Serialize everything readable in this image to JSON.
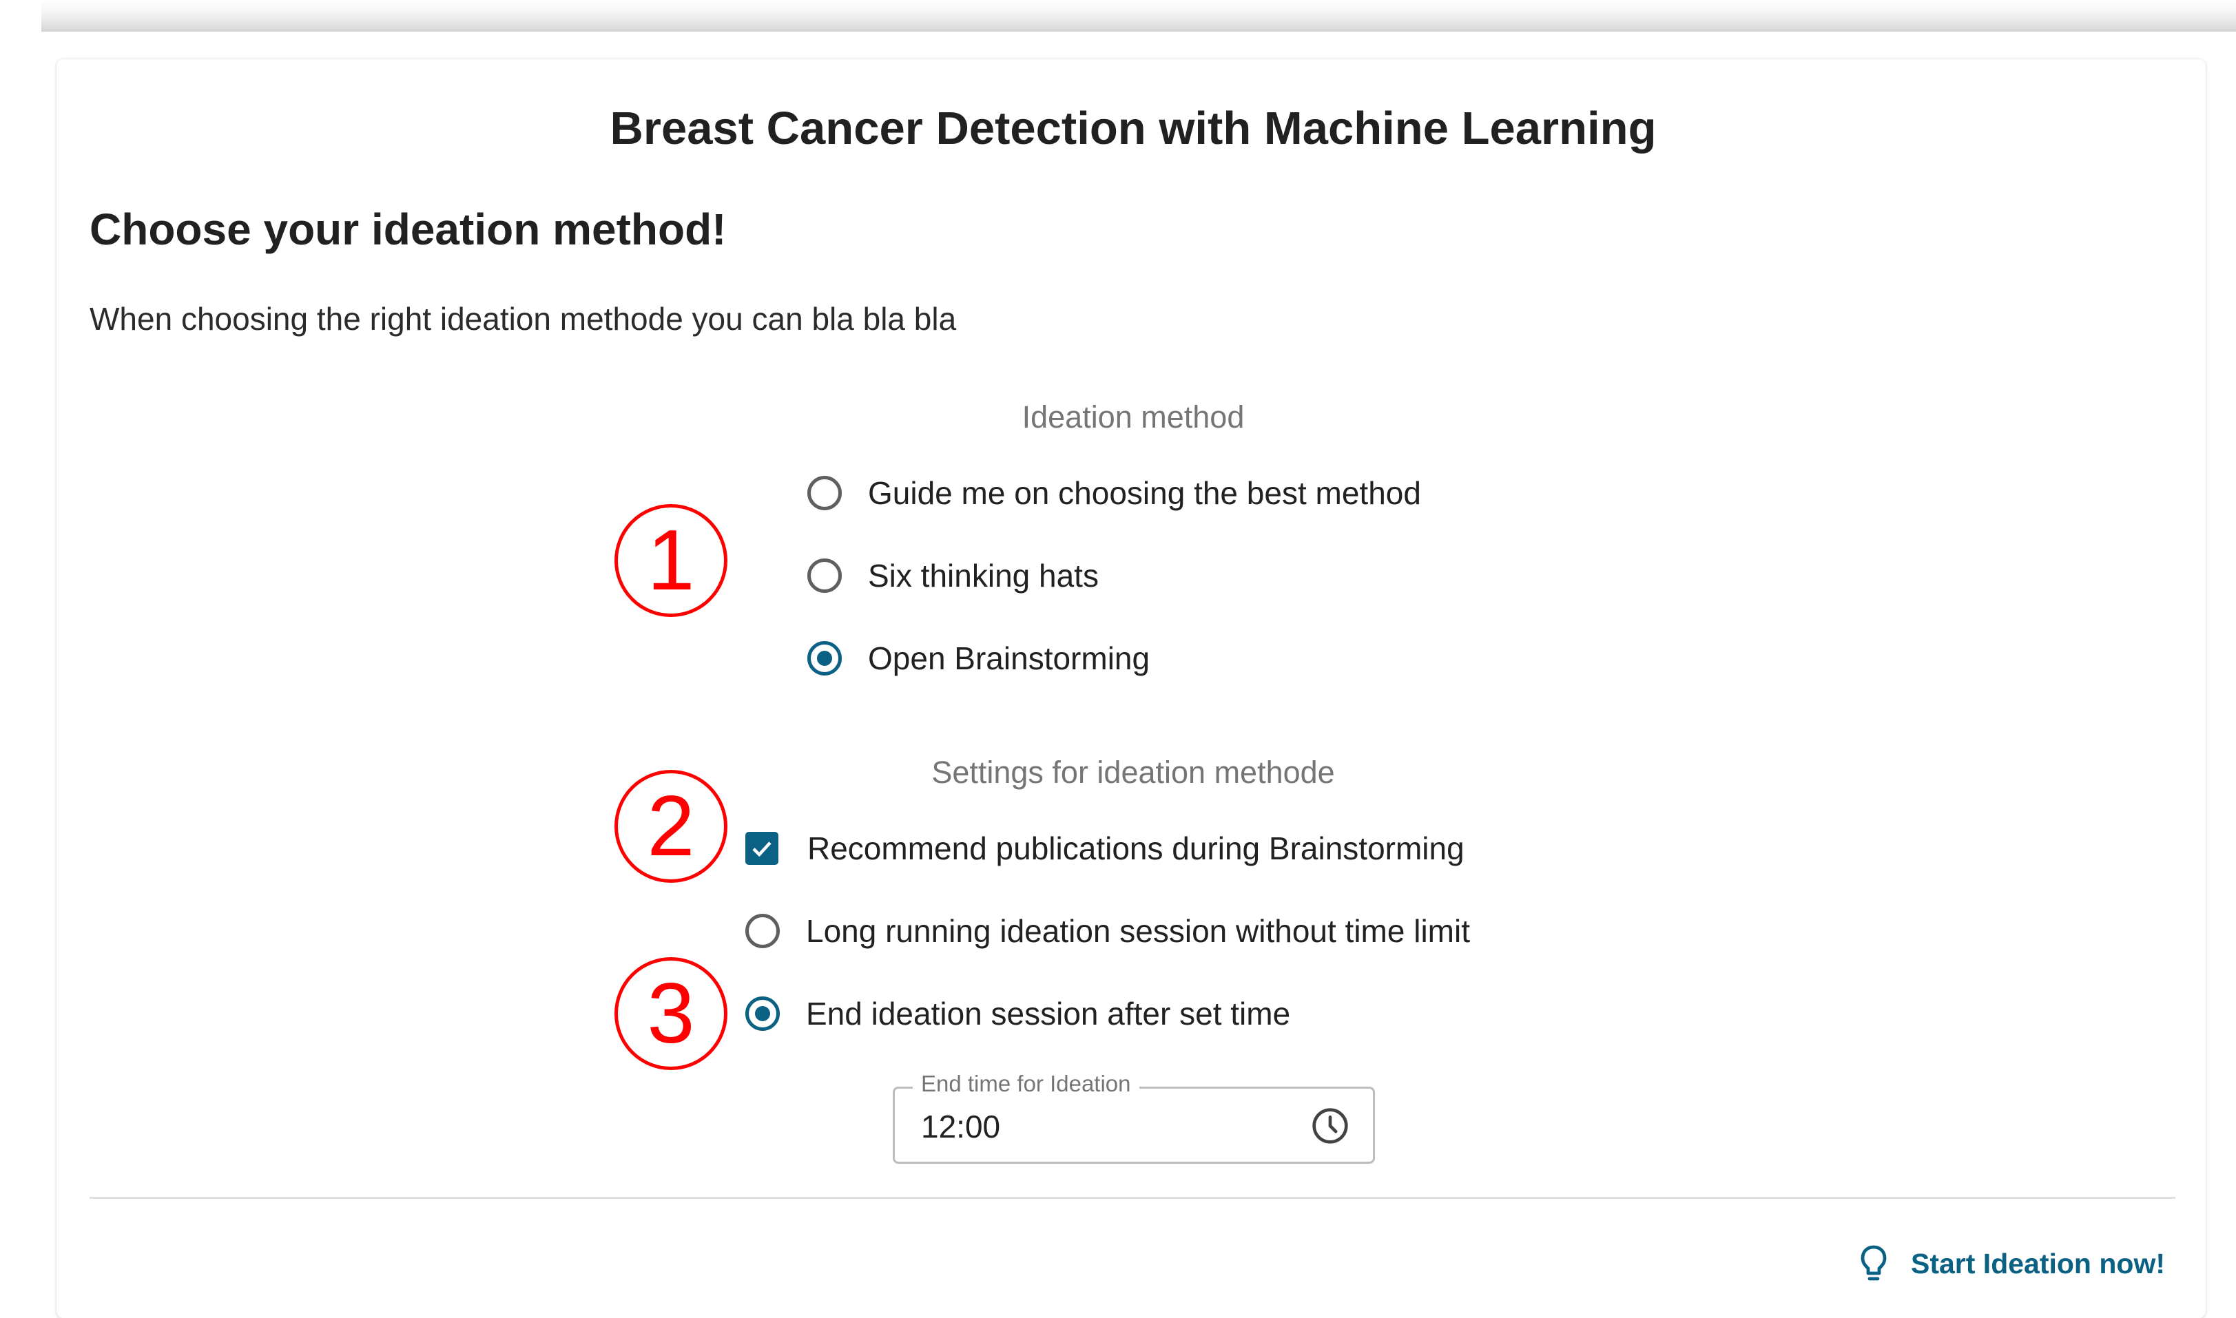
{
  "page": {
    "project_title": "Breast Cancer Detection with Machine Learning",
    "heading": "Choose your ideation method!",
    "description": "When choosing the right ideation methode you can bla bla bla"
  },
  "ideation_method": {
    "label": "Ideation method",
    "options": [
      {
        "label": "Guide me on choosing the best method",
        "selected": false
      },
      {
        "label": "Six thinking hats",
        "selected": false
      },
      {
        "label": "Open Brainstorming",
        "selected": true
      }
    ]
  },
  "settings": {
    "label": "Settings for ideation methode",
    "recommend_publications": {
      "label": "Recommend publications during Brainstorming",
      "checked": true
    },
    "session_options": [
      {
        "label": "Long running ideation session without time limit",
        "selected": false
      },
      {
        "label": "End ideation session after set time",
        "selected": true
      }
    ],
    "end_time": {
      "label": "End time for Ideation",
      "value": "12:00"
    }
  },
  "annotations": [
    "1",
    "2",
    "3"
  ],
  "actions": {
    "start_label": "Start Ideation now!"
  },
  "colors": {
    "accent": "#0b6183",
    "annotation": "#ff0000",
    "text": "#212121",
    "muted": "#757575"
  },
  "icons": {
    "time_field": "clock-icon",
    "start_button": "lightbulb-icon"
  }
}
